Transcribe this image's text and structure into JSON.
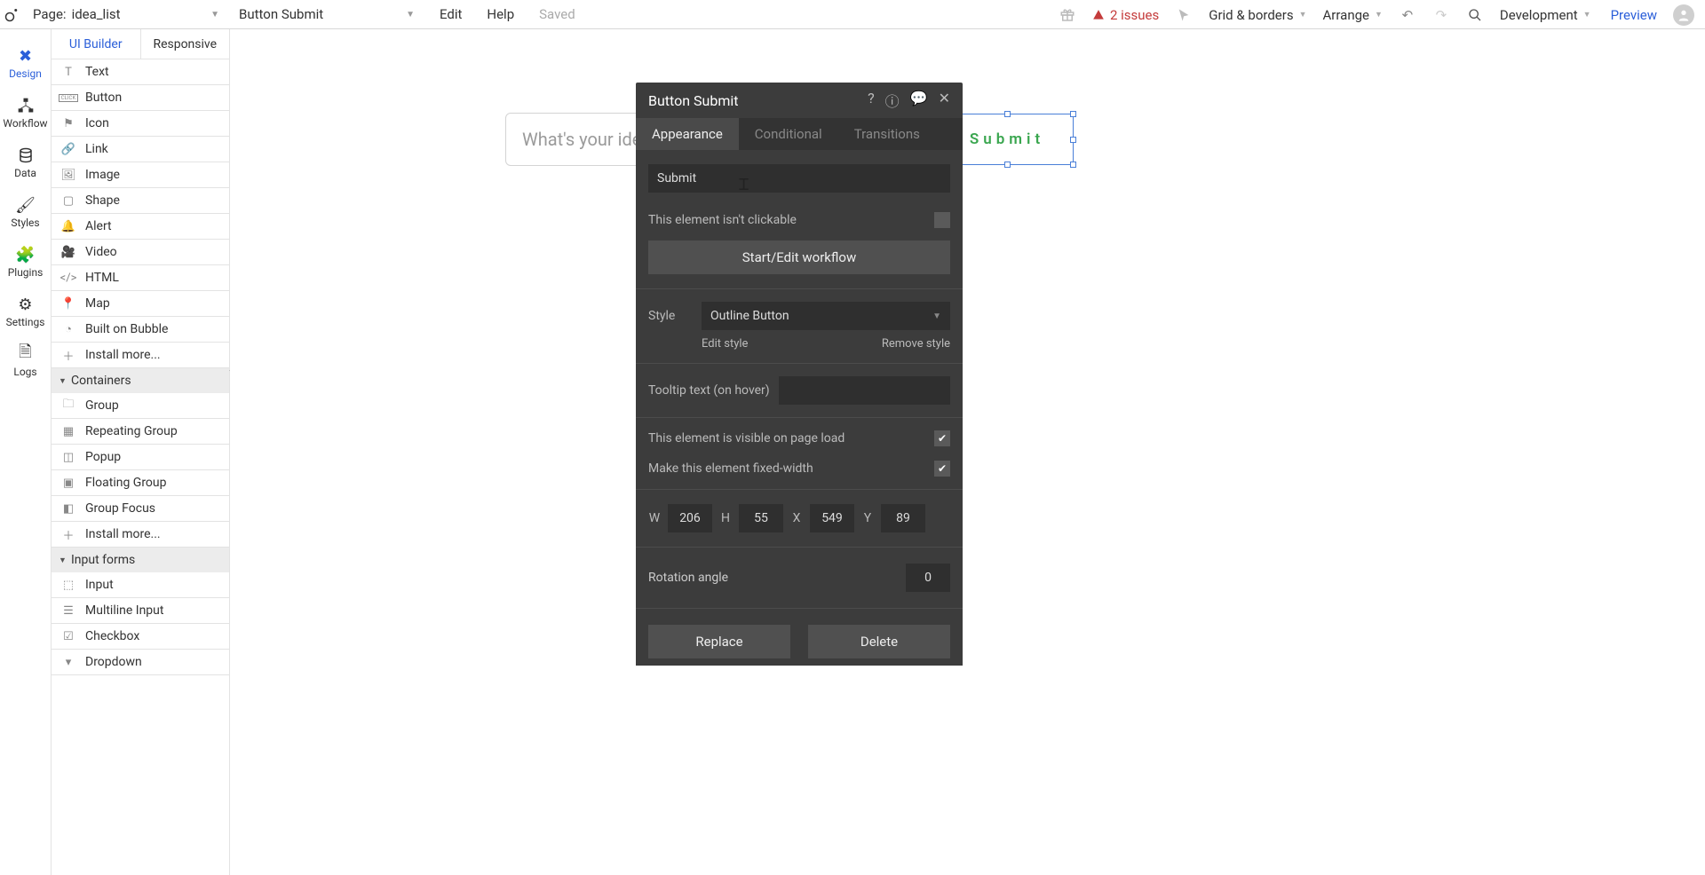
{
  "top": {
    "page_label_prefix": "Page:",
    "page_name": "idea_list",
    "element_name": "Button Submit",
    "menu": {
      "edit": "Edit",
      "help": "Help",
      "saved": "Saved"
    },
    "issues_count": "2 issues",
    "grid_borders": "Grid & borders",
    "arrange": "Arrange",
    "deploy_mode": "Development",
    "preview": "Preview"
  },
  "leftnav": {
    "design": "Design",
    "workflow": "Workflow",
    "data": "Data",
    "styles": "Styles",
    "plugins": "Plugins",
    "settings": "Settings",
    "logs": "Logs"
  },
  "palette": {
    "tab_ui": "UI Builder",
    "tab_resp": "Responsive",
    "visual_items": [
      "Text",
      "Button",
      "Icon",
      "Link",
      "Image",
      "Shape",
      "Alert",
      "Video",
      "HTML",
      "Map",
      "Built on Bubble",
      "Install more..."
    ],
    "containers_header": "Containers",
    "containers_items": [
      "Group",
      "Repeating Group",
      "Popup",
      "Floating Group",
      "Group Focus",
      "Install more..."
    ],
    "inputs_header": "Input forms",
    "inputs_items": [
      "Input",
      "Multiline Input",
      "Checkbox",
      "Dropdown"
    ]
  },
  "canvas": {
    "idea_placeholder": "What's your idea?",
    "button_text": "Submit"
  },
  "panel": {
    "title": "Button Submit",
    "tabs": {
      "appearance": "Appearance",
      "conditional": "Conditional",
      "transitions": "Transitions"
    },
    "name_value": "Submit",
    "not_clickable": "This element isn't clickable",
    "start_workflow": "Start/Edit workflow",
    "style_label": "Style",
    "style_value": "Outline Button",
    "edit_style": "Edit style",
    "remove_style": "Remove style",
    "tooltip_label": "Tooltip text (on hover)",
    "visible_label": "This element is visible on page load",
    "fixed_width_label": "Make this element fixed-width",
    "dims": {
      "w_label": "W",
      "w": "206",
      "h_label": "H",
      "h": "55",
      "x_label": "X",
      "x": "549",
      "y_label": "Y",
      "y": "89"
    },
    "rotation_label": "Rotation angle",
    "rotation": "0",
    "replace": "Replace",
    "delete": "Delete"
  }
}
